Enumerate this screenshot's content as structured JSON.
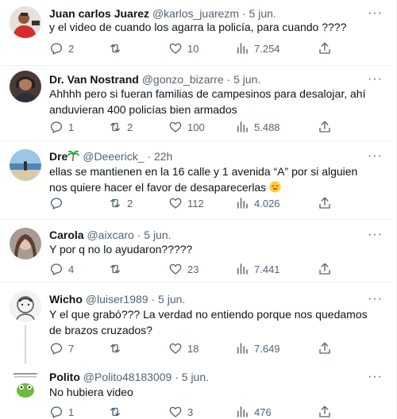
{
  "tweets": [
    {
      "name": "Juan carlos Juarez",
      "handle": "@karlos_juarezm",
      "time": "5 jun.",
      "text": "y el video de cuando los agarra la policía, para cuando ????",
      "replies": "2",
      "retweets": "",
      "likes": "10",
      "views": "7.254",
      "avatar": "man-red-shirt-avatar"
    },
    {
      "name": "Dr. Van Nostrand",
      "handle": "@gonzo_bizarre",
      "time": "5 jun.",
      "text": "Ahhhh pero si fueran familias de campesinos para desalojar, ahí anduvieran 400 policías bien armados",
      "replies": "1",
      "retweets": "2",
      "likes": "100",
      "views": "5.488",
      "avatar": "man-headphones-avatar"
    },
    {
      "name": "Dre",
      "handle": "@Deeerick_",
      "time": "22h",
      "text": "ellas se mantienen en la 16 calle y 1 avenida “A” por si alguien nos quiere hacer el favor de desaparecerlas",
      "replies": "",
      "retweets": "2",
      "likes": "112",
      "views": "4.026",
      "avatar": "beach-avatar",
      "name_emoji": "palm-tree-icon",
      "text_emoji": "heart-eyes-emoji"
    },
    {
      "name": "Carola",
      "handle": "@aixcaro",
      "time": "5 jun.",
      "text": "Y por q no lo ayudaron?????",
      "replies": "4",
      "retweets": "",
      "likes": "23",
      "views": "7.441",
      "avatar": "woman-avatar"
    },
    {
      "name": "Wicho",
      "handle": "@luiser1989",
      "time": "5 jun.",
      "text": "Y el que grabó??? La verdad no entiendo porque nos quedamos de brazos cruzados?",
      "replies": "7",
      "retweets": "",
      "likes": "18",
      "views": "7.649",
      "avatar": "sketch-avatar"
    },
    {
      "name": "Polito",
      "handle": "@Polito48183009",
      "time": "5 jun.",
      "text": "No hubiera video",
      "replies": "1",
      "retweets": "",
      "likes": "3",
      "views": "476",
      "avatar": "frog-meme-avatar"
    }
  ],
  "separator": "·",
  "more_glyph": "···",
  "colors": {
    "text": "#0f1419",
    "muted": "#536471",
    "border": "#eff3f4"
  }
}
